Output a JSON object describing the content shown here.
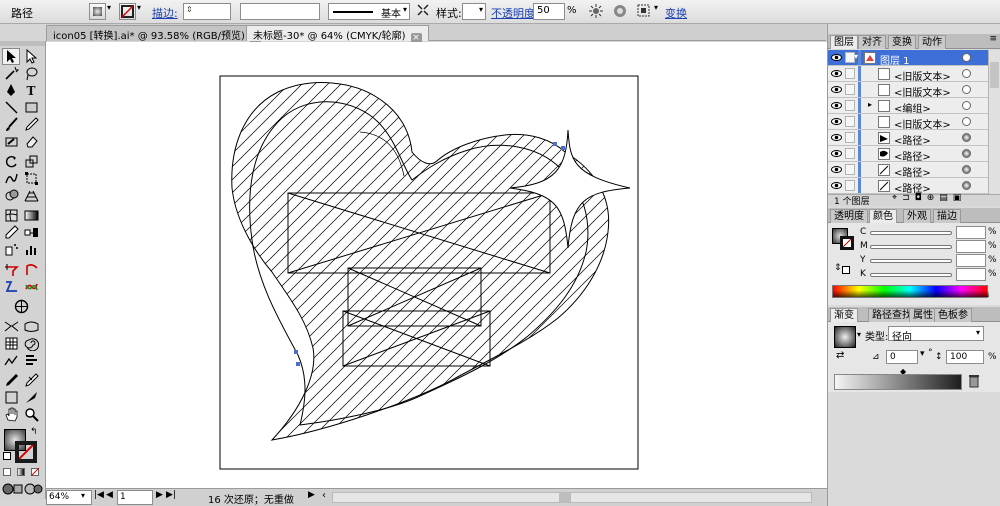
{
  "control_bar": {
    "selection_type": "路径",
    "stroke_label": "描边:",
    "stroke_profile": "基本",
    "style_label": "样式:",
    "opacity_label": "不透明度:",
    "opacity_value": "50",
    "opacity_unit": "%",
    "transform_label": "变换"
  },
  "document_tabs": [
    {
      "label": "icon05 [转换].ai* @ 93.58% (RGB/预览)",
      "close": "×",
      "active": false
    },
    {
      "label": "未标题-30* @ 64% (CMYK/轮廓)",
      "close": "×",
      "active": true
    }
  ],
  "status_bar": {
    "zoom": "64%",
    "page": "1",
    "message": "16 次还原；无重做"
  },
  "layers_panel": {
    "tabs": [
      "图层",
      "对齐",
      "变换",
      "动作"
    ],
    "rows": [
      {
        "name": "图层 1",
        "expander": "▾",
        "selected": true,
        "thumb": "layer",
        "target": "hollow"
      },
      {
        "name": "<旧版文本>",
        "expander": "",
        "selected": false,
        "thumb": "blank",
        "target": "hollow"
      },
      {
        "name": "<旧版文本>",
        "expander": "",
        "selected": false,
        "thumb": "blank",
        "target": "hollow"
      },
      {
        "name": "<编组>",
        "expander": "▸",
        "selected": false,
        "thumb": "blank",
        "target": "hollow"
      },
      {
        "name": "<旧版文本>",
        "expander": "",
        "selected": false,
        "thumb": "blank",
        "target": "hollow"
      },
      {
        "name": "<路径>",
        "expander": "",
        "selected": false,
        "thumb": "brush",
        "target": "filled"
      },
      {
        "name": "<路径>",
        "expander": "",
        "selected": false,
        "thumb": "splash",
        "target": "filled"
      },
      {
        "name": "<路径>",
        "expander": "",
        "selected": false,
        "thumb": "line",
        "target": "filled"
      },
      {
        "name": "<路径>",
        "expander": "",
        "selected": false,
        "thumb": "line",
        "target": "filled"
      }
    ],
    "layer_count": "1 个图层"
  },
  "color_panel": {
    "tabs": [
      "透明度",
      "颜色",
      "外观",
      "描边"
    ],
    "channels": [
      "C",
      "M",
      "Y",
      "K"
    ],
    "unit": "%"
  },
  "gradient_panel": {
    "tabs": [
      "渐变",
      "路径查找",
      "属性",
      "色板参"
    ],
    "type_label": "类型:",
    "type_value": "径向",
    "angle_value": "0",
    "degree_symbol": "°",
    "ratio_value": "100",
    "ratio_unit": "%"
  },
  "icons": [
    "selection-tool-icon",
    "direct-selection-icon",
    "magic-wand-icon",
    "lasso-icon",
    "pen-icon",
    "type-tool-icon",
    "line-tool-icon",
    "rectangle-tool-icon",
    "paintbrush-icon",
    "pencil-icon",
    "eraser-icon",
    "rotate-icon",
    "scale-icon",
    "warp-icon",
    "free-transform-icon",
    "symbol-sprayer-icon",
    "graph-icon",
    "mesh-icon",
    "gradient-tool-icon",
    "eyedropper-icon",
    "blend-icon",
    "live-paint-icon",
    "slice-icon",
    "scissors-icon",
    "hand-icon",
    "zoom-icon",
    "eye-icon",
    "close-icon"
  ],
  "colors": {
    "selection_blue": "#3d6fd6",
    "link_blue": "#1a3fb0"
  }
}
